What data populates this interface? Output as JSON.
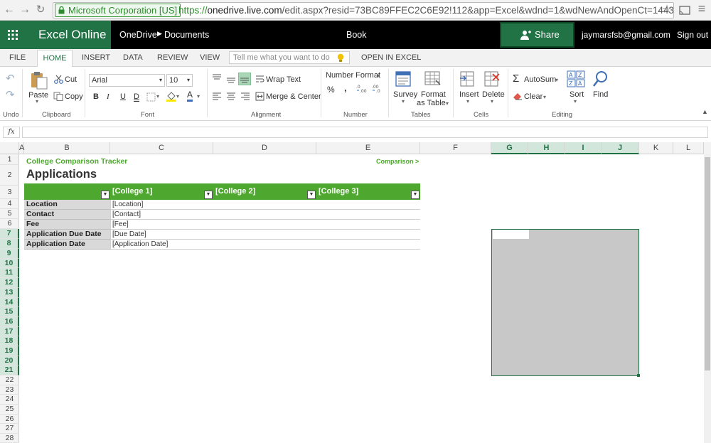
{
  "browser": {
    "site_identity": "Microsoft Corporation [US]",
    "url_scheme": "https://",
    "url_domain": "onedrive.live.com",
    "url_path": "/edit.aspx?resid=73BC89FFEC2C6E92!112&app=Excel&wdnd=1&wdNewAndOpenCt=1443704"
  },
  "app": {
    "brand": "Excel Online",
    "breadcrumb_root": "OneDrive",
    "breadcrumb_folder": "Documents",
    "book_name": "Book",
    "share_label": "Share",
    "user_email": "jaymarsfsb@gmail.com",
    "sign_out": "Sign out"
  },
  "tabs": {
    "file": "FILE",
    "home": "HOME",
    "insert": "INSERT",
    "data": "DATA",
    "review": "REVIEW",
    "view": "VIEW",
    "tell_me_placeholder": "Tell me what you want to do",
    "open_in_excel": "OPEN IN EXCEL"
  },
  "ribbon": {
    "undo_group": "Undo",
    "clipboard": {
      "group": "Clipboard",
      "paste": "Paste",
      "cut": "Cut",
      "copy": "Copy"
    },
    "font": {
      "group": "Font",
      "name": "Arial",
      "size": "10",
      "bold": "B",
      "italic": "I",
      "underline": "U",
      "double_underline": "D",
      "font_color_glyph": "A"
    },
    "alignment": {
      "group": "Alignment",
      "wrap": "Wrap Text",
      "merge": "Merge & Center"
    },
    "number": {
      "group": "Number",
      "format": "Number Format",
      "percent": "%",
      "comma": ","
    },
    "tables": {
      "group": "Tables",
      "survey": "Survey",
      "format_as_table_1": "Format",
      "format_as_table_2": "as Table"
    },
    "cells": {
      "group": "Cells",
      "insert": "Insert",
      "delete": "Delete"
    },
    "editing": {
      "group": "Editing",
      "autosum": "AutoSum",
      "clear": "Clear",
      "sort": "Sort",
      "find": "Find"
    }
  },
  "formula_bar": {
    "fx": "fx",
    "value": ""
  },
  "grid": {
    "columns": [
      "A",
      "B",
      "C",
      "D",
      "E",
      "F",
      "G",
      "H",
      "I",
      "J",
      "K",
      "L"
    ],
    "selected_columns": [
      "G",
      "H",
      "I",
      "J"
    ],
    "rows": [
      "1",
      "2",
      "3",
      "4",
      "5",
      "6",
      "7",
      "8",
      "9",
      "10",
      "11",
      "12",
      "13",
      "14",
      "15",
      "16",
      "17",
      "18",
      "19",
      "20",
      "21",
      "22",
      "23",
      "24",
      "25",
      "26",
      "27",
      "28"
    ],
    "selected_rows": [
      "7",
      "8",
      "9",
      "10",
      "11",
      "12",
      "13",
      "14",
      "15",
      "16",
      "17",
      "18",
      "19",
      "20",
      "21"
    ]
  },
  "sheet": {
    "subtitle": "College Comparison Tracker",
    "title": "Applications",
    "comparison_link": "Comparison >",
    "table": {
      "headers": [
        "",
        "[College 1]",
        "[College 2]",
        "[College 3]"
      ],
      "rows": [
        {
          "label": "Location",
          "value": "[Location]"
        },
        {
          "label": "Contact",
          "value": "[Contact]"
        },
        {
          "label": "Fee",
          "value": "[Fee]"
        },
        {
          "label": "Application Due Date",
          "value": "[Due Date]"
        },
        {
          "label": "Application Date",
          "value": "[Application Date]"
        }
      ]
    }
  },
  "colors": {
    "excel_green": "#217346",
    "table_green": "#4ea72e",
    "link_green": "#2e8b2e"
  }
}
